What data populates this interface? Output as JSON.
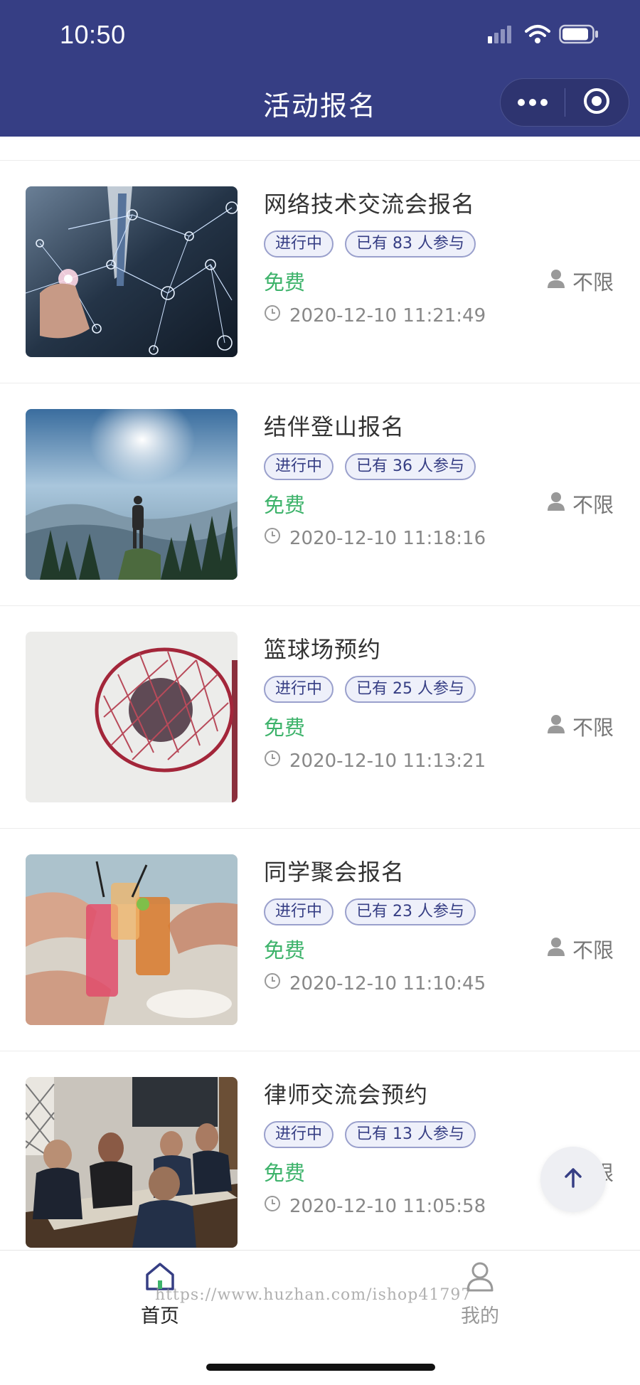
{
  "status_bar": {
    "time": "10:50"
  },
  "header": {
    "title": "活动报名"
  },
  "activities": [
    {
      "title": "网络技术交流会报名",
      "status": "进行中",
      "participants": "已有 83 人参与",
      "price": "免费",
      "limit": "不限",
      "datetime": "2020-12-10 11:21:49",
      "image": "network-tech"
    },
    {
      "title": "结伴登山报名",
      "status": "进行中",
      "participants": "已有 36 人参与",
      "price": "免费",
      "limit": "不限",
      "datetime": "2020-12-10 11:18:16",
      "image": "mountain-hiker"
    },
    {
      "title": "篮球场预约",
      "status": "进行中",
      "participants": "已有 25 人参与",
      "price": "免费",
      "limit": "不限",
      "datetime": "2020-12-10 11:13:21",
      "image": "basketball-hoop"
    },
    {
      "title": "同学聚会报名",
      "status": "进行中",
      "participants": "已有 23 人参与",
      "price": "免费",
      "limit": "不限",
      "datetime": "2020-12-10 11:10:45",
      "image": "drinks-toast"
    },
    {
      "title": "律师交流会预约",
      "status": "进行中",
      "participants": "已有 13 人参与",
      "price": "免费",
      "limit": "不限",
      "datetime": "2020-12-10 11:05:58",
      "image": "lawyers-meeting"
    }
  ],
  "tabbar": {
    "home_label": "首页",
    "mine_label": "我的"
  },
  "watermark": "https://www.huzhan.com/ishop41797",
  "colors": {
    "header_bg": "#363e84",
    "price": "#3eb36b",
    "tag_text": "#363e84",
    "tag_border": "#9aa0cc"
  },
  "icons": {
    "back_to_top": "arrow-up-icon",
    "home": "home-icon",
    "mine": "user-icon",
    "time": "clock-icon",
    "limit": "person-icon"
  }
}
